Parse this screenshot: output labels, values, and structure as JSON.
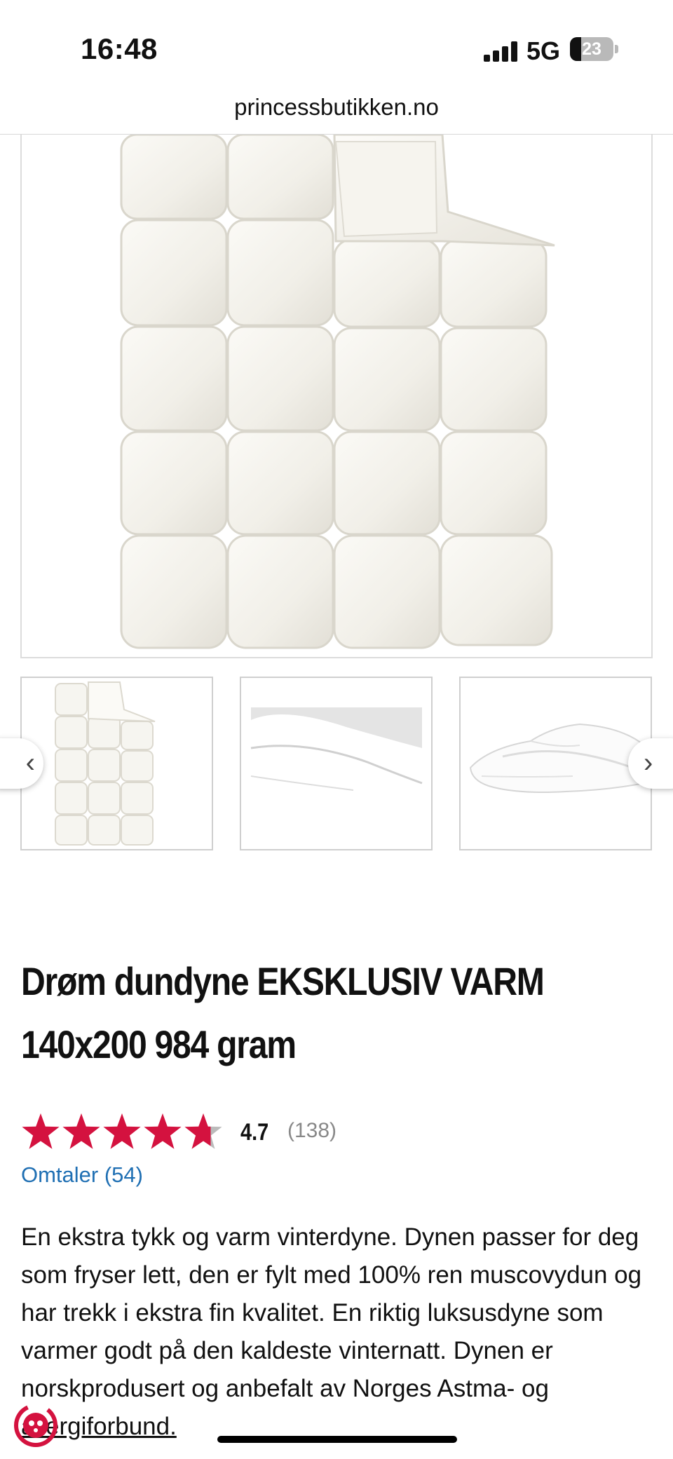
{
  "status_bar": {
    "time": "16:48",
    "network": "5G",
    "battery": "23",
    "battery_level": 0.23
  },
  "browser": {
    "url": "princessbutikken.no"
  },
  "gallery": {
    "thumbnails": [
      {
        "name": "thumb-duvet-flat"
      },
      {
        "name": "thumb-pillow"
      },
      {
        "name": "thumb-duvet-folded"
      }
    ],
    "prev_arrow": "‹",
    "next_arrow": "›"
  },
  "product": {
    "title_line1": "Drøm dundyne EKSKLUSIV VARM",
    "title_line2": "140x200 984 gram",
    "rating_value": "4.7",
    "rating_count": "(138)",
    "rating_stars": 4.7,
    "reviews_link": "Omtaler (54)",
    "description_main": "En ekstra tykk og varm vinterdyne. Dynen passer for deg som fryser lett, den er fylt med 100% ren muscovydun og har trekk i ekstra fin kvalitet. En riktig luksusdyne som varmer godt på den kaldeste vinternatt. Dynen er norskprodusert og anbefalt av Norges Astma- og ",
    "description_link": "allergiforbund."
  },
  "colors": {
    "star": "#d4123f",
    "star_empty": "#bbbbbb",
    "link": "#1f6fb3"
  }
}
